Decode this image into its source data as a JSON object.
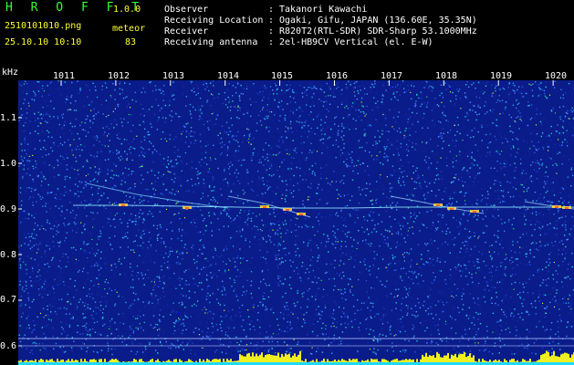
{
  "header": {
    "app_title": "H R O F F T",
    "app_version": "1.0.0",
    "file_name": "2510101010.png",
    "mode": "meteor",
    "datetime": "25.10.10 10:10",
    "count": "83",
    "info": [
      {
        "label": "Observer",
        "sep": ":",
        "value": "Takanori Kawachi"
      },
      {
        "label": "Receiving Location",
        "sep": ":",
        "value": "Ogaki, Gifu, JAPAN (136.60E, 35.35N)"
      },
      {
        "label": "Receiver",
        "sep": ":",
        "value": "R820T2(RTL-SDR) SDR-Sharp 53.1000MHz"
      },
      {
        "label": "Receiving antenna",
        "sep": ":",
        "value": "2el-HB9CV Vertical (el. E-W)"
      }
    ]
  },
  "axes": {
    "y_unit": "kHz",
    "y_ticks": [
      "1.1",
      "1.0",
      "0.9",
      "0.8",
      "0.7",
      "0.6"
    ],
    "x_ticks": [
      "1011",
      "1012",
      "1013",
      "1014",
      "1015",
      "1016",
      "1017",
      "1018",
      "1019",
      "1020"
    ]
  },
  "colors": {
    "background": "#000000",
    "spectrogram_base": "#0a1c8a",
    "title_green": "#33ff33",
    "accent_yellow": "#ffff33",
    "trace_cyan": "#8fe8ff"
  }
}
